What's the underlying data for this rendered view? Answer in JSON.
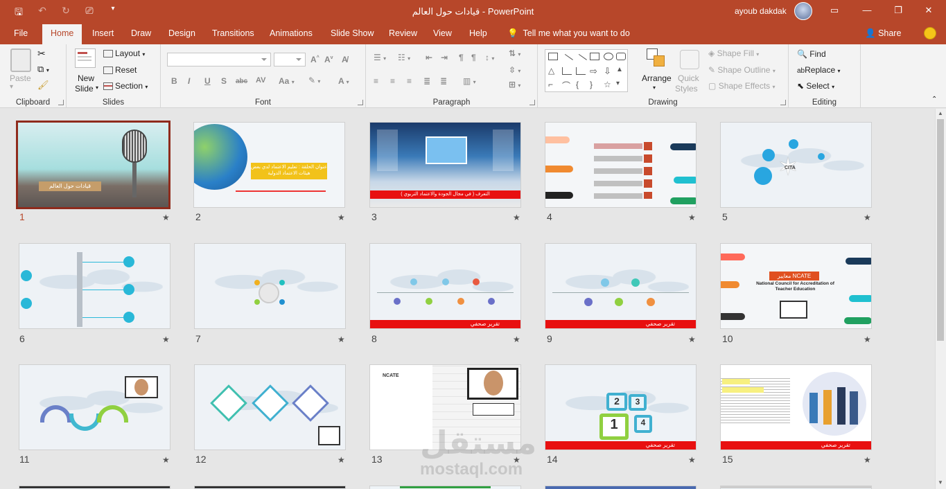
{
  "window": {
    "doc_title": "قيادات حول العالم  -  PowerPoint",
    "user": "ayoub dakdak"
  },
  "tabs": [
    "File",
    "Home",
    "Insert",
    "Draw",
    "Design",
    "Transitions",
    "Animations",
    "Slide Show",
    "Review",
    "View",
    "Help"
  ],
  "tell_me": "Tell me what you want to do",
  "share": "Share",
  "ribbon": {
    "clipboard": {
      "paste": "Paste",
      "label": "Clipboard"
    },
    "slides": {
      "new_slide_1": "New",
      "new_slide_2": "Slide",
      "layout": "Layout",
      "reset": "Reset",
      "section": "Section",
      "label": "Slides"
    },
    "font": {
      "label": "Font"
    },
    "paragraph": {
      "label": "Paragraph"
    },
    "drawing": {
      "arrange": "Arrange",
      "quick_styles_1": "Quick",
      "quick_styles_2": "Styles",
      "shape_fill": "Shape Fill",
      "shape_outline": "Shape Outline",
      "shape_effects": "Shape Effects",
      "label": "Drawing"
    },
    "editing": {
      "find": "Find",
      "replace": "Replace",
      "select": "Select",
      "label": "Editing"
    }
  },
  "slides": [
    {
      "num": "1",
      "title": "قيادات حول العالم"
    },
    {
      "num": "2",
      "title": "عنوان الحلقة : تعليم الاعتماد لدي بعض هيئات الاعتماد الدولية"
    },
    {
      "num": "3",
      "title": "التعرف ( في مجال الجودة والاعتماد التربوي )"
    },
    {
      "num": "4",
      "title": ""
    },
    {
      "num": "5",
      "title": "CITA"
    },
    {
      "num": "6",
      "title": ""
    },
    {
      "num": "7",
      "title": ""
    },
    {
      "num": "8",
      "title": ""
    },
    {
      "num": "9",
      "title": ""
    },
    {
      "num": "10",
      "title": "معايير NCATE",
      "subtitle": "National Council for Accreditation of Teacher Education"
    },
    {
      "num": "11",
      "title": ""
    },
    {
      "num": "12",
      "title": ""
    },
    {
      "num": "13",
      "title": "NCATE"
    },
    {
      "num": "14",
      "title": ""
    },
    {
      "num": "15",
      "title": ""
    }
  ],
  "red_bar_text": "تقرير صحفي",
  "watermark": {
    "arabic": "مستقل",
    "latin": "mostaql.com"
  },
  "colors": {
    "accent": "#b7472a",
    "selected_border": "#8f2b1c",
    "red_bar": "#e81010"
  }
}
